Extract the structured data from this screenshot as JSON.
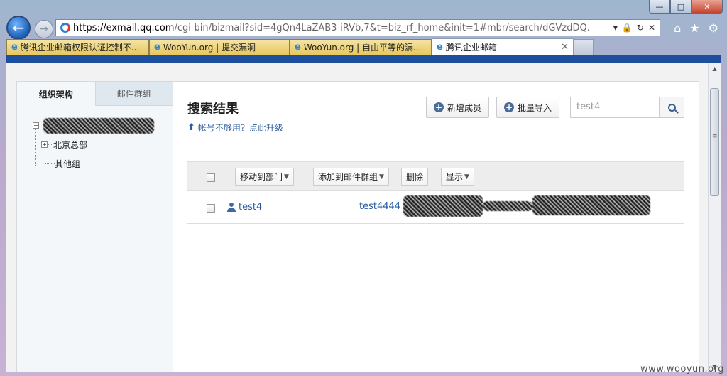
{
  "window": {
    "minimize": "—",
    "maximize": "□",
    "close": "✕"
  },
  "nav": {
    "back": "←",
    "forward": "→",
    "url_host": "https://exmail.qq.com",
    "url_rest": "/cgi-bin/bizmail?sid=4gQn4LaZAB3-iRVb,7&t=biz_rf_home&init=1#mbr/search/dGVzdDQ.",
    "addr_tools": [
      "▾",
      "🔒",
      "↻",
      "✕"
    ],
    "home": "⌂",
    "favorites": "★",
    "settings": "⚙"
  },
  "tabs": [
    {
      "label": "腾讯企业邮箱权限认证控制不...",
      "icon": "e"
    },
    {
      "label": "WooYun.org | 提交漏洞",
      "icon": "e"
    },
    {
      "label": "WooYun.org | 自由平等的漏...",
      "icon": "e"
    },
    {
      "label": "腾讯企业邮箱",
      "icon": "e",
      "close": "✕"
    }
  ],
  "left_panel": {
    "tabs": [
      "组织架构",
      "邮件群组"
    ],
    "tree": {
      "root_toggle": "−",
      "children": [
        {
          "toggle": "+",
          "label": "北京总部"
        },
        {
          "label": "其他组"
        }
      ]
    }
  },
  "main": {
    "title": "搜索结果",
    "upgrade_link": "帐号不够用？点此升级",
    "add_member": "新增成员",
    "batch_import": "批量导入",
    "search_value": "test4",
    "toolbar": {
      "move_to_dept": "移动到部门",
      "add_to_group": "添加到邮件群组",
      "delete": "删除",
      "display": "显示"
    },
    "results": [
      {
        "name": "test4",
        "email": "test4444"
      }
    ]
  },
  "watermark": "www.wooyun.org",
  "colors": {
    "top_band": "#1e4f9c",
    "link": "#2a5d9f",
    "tab_inactive": "#e7c75f"
  }
}
